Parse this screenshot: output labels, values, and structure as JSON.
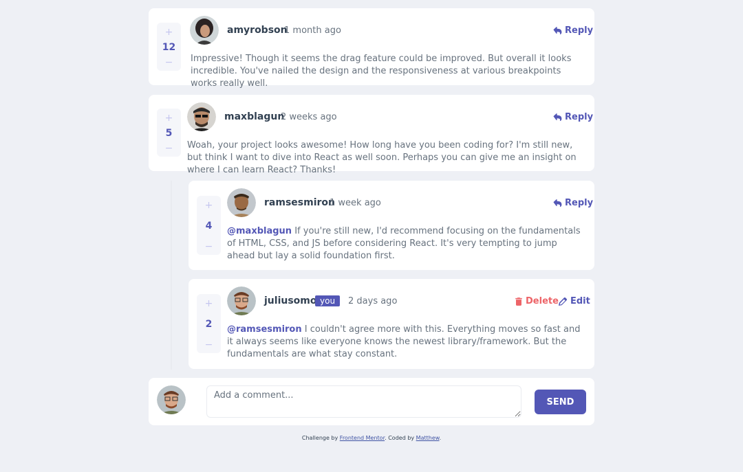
{
  "comments": [
    {
      "score": "12",
      "username": "amyrobson",
      "time": "1 month ago",
      "reply_label": "Reply",
      "text": "Impressive! Though it seems the drag feature could be improved. But overall it looks incredible. You've nailed the design and the responsiveness at various breakpoints works really well."
    },
    {
      "score": "5",
      "username": "maxblagun",
      "time": "2 weeks ago",
      "reply_label": "Reply",
      "text": "Woah, your project looks awesome! How long have you been coding for? I'm still new, but think I want to dive into React as well soon. Perhaps you can give me an insight on where I can learn React? Thanks!"
    }
  ],
  "replies": [
    {
      "score": "4",
      "username": "ramsesmiron",
      "time": "1 week ago",
      "reply_label": "Reply",
      "mention": "@maxblagun",
      "text": "If you're still new, I'd recommend focusing on the fundamentals of HTML, CSS, and JS before considering React. It's very tempting to jump ahead but lay a solid foundation first."
    },
    {
      "score": "2",
      "username": "juliusomo",
      "you_label": "you",
      "time": "2 days ago",
      "delete_label": "Delete",
      "edit_label": "Edit",
      "mention": "@ramsesmiron",
      "text": "I couldn't agree more with this. Everything moves so fast and it always seems like everyone knows the newest library/framework. But the fundamentals are what stay constant."
    }
  ],
  "composer": {
    "placeholder": "Add a comment...",
    "send_label": "SEND"
  },
  "vote": {
    "plus": "+",
    "minus": "−"
  },
  "attribution": {
    "prefix": "Challenge by",
    "link1": "Frontend Mentor",
    "middle": ". Coded by",
    "link2": "Matthew",
    "suffix": "."
  },
  "colors": {
    "accent": "#5357b6",
    "danger": "#ed6468",
    "background": "#eef0f5"
  }
}
